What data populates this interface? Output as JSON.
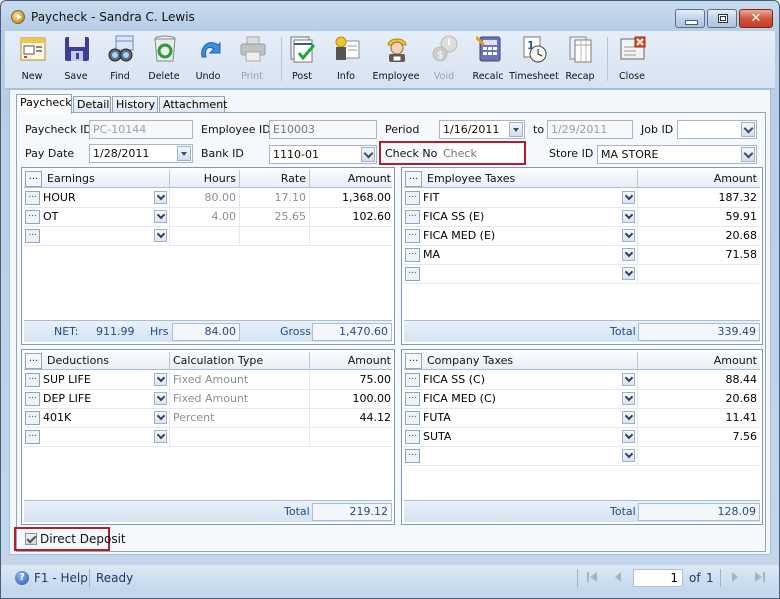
{
  "window": {
    "title": "Paycheck - Sandra C. Lewis",
    "close_glyph": "✕"
  },
  "toolbar": [
    {
      "id": "new",
      "label": "New",
      "icon": "new-icon",
      "enabled": true
    },
    {
      "id": "save",
      "label": "Save",
      "icon": "save-icon",
      "enabled": true
    },
    {
      "id": "find",
      "label": "Find",
      "icon": "binoculars-icon",
      "enabled": true
    },
    {
      "id": "delete",
      "label": "Delete",
      "icon": "recycle-bin-icon",
      "enabled": true
    },
    {
      "id": "undo",
      "label": "Undo",
      "icon": "undo-arrow-icon",
      "enabled": true
    },
    {
      "id": "print",
      "label": "Print",
      "icon": "printer-icon",
      "enabled": false
    },
    {
      "id": "post",
      "label": "Post",
      "icon": "post-checkmark-icon",
      "enabled": true
    },
    {
      "id": "info",
      "label": "Info",
      "icon": "info-card-icon",
      "enabled": true
    },
    {
      "id": "employee",
      "label": "Employee",
      "icon": "employee-hardhat-icon",
      "enabled": true
    },
    {
      "id": "void",
      "label": "Void",
      "icon": "void-dollar-icon",
      "enabled": false
    },
    {
      "id": "recalc",
      "label": "Recalc",
      "icon": "calculator-icon",
      "enabled": true
    },
    {
      "id": "timesheet",
      "label": "Timesheet",
      "icon": "timesheet-clock-icon",
      "enabled": true
    },
    {
      "id": "recap",
      "label": "Recap",
      "icon": "recap-sheet-icon",
      "enabled": true
    },
    {
      "id": "close",
      "label": "Close",
      "icon": "close-form-icon",
      "enabled": true
    }
  ],
  "tabs": [
    "Paycheck",
    "Detail",
    "History",
    "Attachment"
  ],
  "active_tab": "Paycheck",
  "form": {
    "paycheck_id_label": "Paycheck ID",
    "paycheck_id": "PC-10144",
    "employee_id_label": "Employee ID",
    "employee_id": "E10003",
    "period_label": "Period",
    "period_from": "1/16/2011",
    "to_label": "to",
    "period_to": "1/29/2011",
    "job_id_label": "Job ID",
    "job_id": "",
    "pay_date_label": "Pay Date",
    "pay_date": "1/28/2011",
    "bank_id_label": "Bank ID",
    "bank_id": "1110-01",
    "check_no_label": "Check No",
    "check_no_placeholder": "Check",
    "store_id_label": "Store ID",
    "store_id": "MA STORE"
  },
  "earnings": {
    "headers": {
      "name": "Earnings",
      "hours": "Hours",
      "rate": "Rate",
      "amount": "Amount"
    },
    "rows": [
      {
        "name": "HOUR",
        "hours": "80.00",
        "rate": "17.10",
        "amount": "1,368.00"
      },
      {
        "name": "OT",
        "hours": "4.00",
        "rate": "25.65",
        "amount": "102.60"
      },
      {
        "name": "",
        "hours": "",
        "rate": "",
        "amount": ""
      }
    ],
    "footer": {
      "net_label": "NET:",
      "net": "911.99",
      "hrs_label": "Hrs",
      "hrs": "84.00",
      "gross_label": "Gross",
      "gross": "1,470.60"
    }
  },
  "employee_taxes": {
    "headers": {
      "name": "Employee Taxes",
      "amount": "Amount"
    },
    "rows": [
      {
        "name": "FIT",
        "amount": "187.32"
      },
      {
        "name": "FICA SS (E)",
        "amount": "59.91"
      },
      {
        "name": "FICA MED (E)",
        "amount": "20.68"
      },
      {
        "name": "MA",
        "amount": "71.58"
      },
      {
        "name": "",
        "amount": ""
      }
    ],
    "footer": {
      "total_label": "Total",
      "total": "339.49"
    }
  },
  "deductions": {
    "headers": {
      "name": "Deductions",
      "calc": "Calculation Type",
      "amount": "Amount"
    },
    "rows": [
      {
        "name": "SUP LIFE",
        "calc": "Fixed Amount",
        "amount": "75.00"
      },
      {
        "name": "DEP LIFE",
        "calc": "Fixed Amount",
        "amount": "100.00"
      },
      {
        "name": "401K",
        "calc": "Percent",
        "amount": "44.12"
      },
      {
        "name": "",
        "calc": "",
        "amount": ""
      }
    ],
    "footer": {
      "total_label": "Total",
      "total": "219.12"
    }
  },
  "company_taxes": {
    "headers": {
      "name": "Company Taxes",
      "amount": "Amount"
    },
    "rows": [
      {
        "name": "FICA SS (C)",
        "amount": "88.44"
      },
      {
        "name": "FICA MED (C)",
        "amount": "20.68"
      },
      {
        "name": "FUTA",
        "amount": "11.41"
      },
      {
        "name": "SUTA",
        "amount": "7.56"
      },
      {
        "name": "",
        "amount": ""
      }
    ],
    "footer": {
      "total_label": "Total",
      "total": "128.09"
    }
  },
  "direct_deposit": {
    "label": "Direct Deposit",
    "checked": true
  },
  "statusbar": {
    "help": "F1 - Help",
    "status": "Ready",
    "page": "1",
    "of_label": "of",
    "total_pages": "1"
  },
  "ellipsis": "...",
  "accent_red": "#b2202a"
}
